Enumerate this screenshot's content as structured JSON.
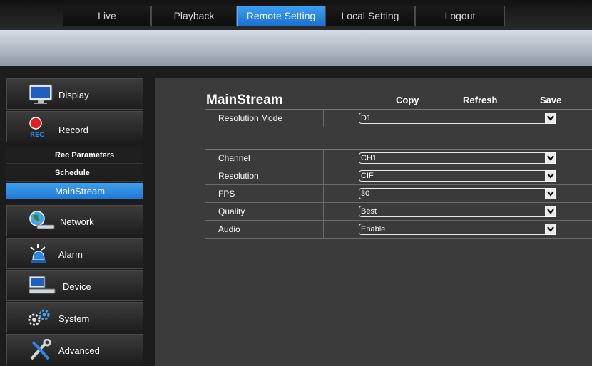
{
  "nav": {
    "tabs": [
      {
        "label": "Live"
      },
      {
        "label": "Playback"
      },
      {
        "label": "Remote Setting",
        "active": true
      },
      {
        "label": "Local Setting"
      },
      {
        "label": "Logout"
      }
    ]
  },
  "sidebar": {
    "display": "Display",
    "record": "Record",
    "rec_badge": "REC",
    "sub": {
      "rec_parameters": "Rec Parameters",
      "schedule": "Schedule",
      "mainstream": "MainStream"
    },
    "network": "Network",
    "alarm": "Alarm",
    "device": "Device",
    "system": "System",
    "advanced": "Advanced"
  },
  "main": {
    "title": "MainStream",
    "copy": "Copy",
    "refresh": "Refresh",
    "save": "Save",
    "resolution_mode": {
      "label": "Resolution Mode",
      "value": "D1"
    },
    "rows": [
      {
        "label": "Channel",
        "value": "CH1"
      },
      {
        "label": "Resolution",
        "value": "CIF"
      },
      {
        "label": "FPS",
        "value": "30"
      },
      {
        "label": "Quality",
        "value": "Best"
      },
      {
        "label": "Audio",
        "value": "Enable"
      }
    ]
  },
  "colors": {
    "active_blue": "#2a86e0",
    "panel": "#3b3b3b",
    "background": "#1c1c1c"
  }
}
